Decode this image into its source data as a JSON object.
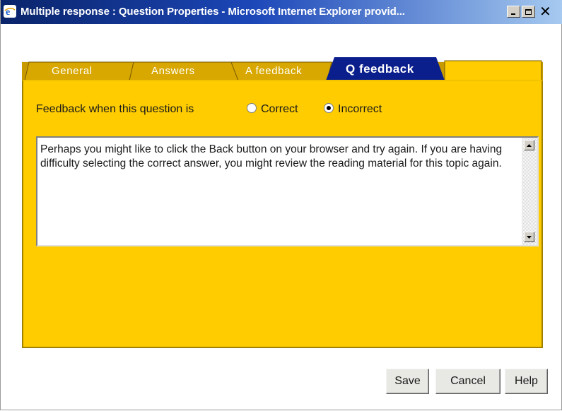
{
  "window": {
    "title": "Multiple response : Question Properties - Microsoft Internet Explorer provid..."
  },
  "tabs": [
    {
      "label": "General",
      "active": false
    },
    {
      "label": "Answers",
      "active": false
    },
    {
      "label": "A feedback",
      "active": false
    },
    {
      "label": "Q feedback",
      "active": true
    }
  ],
  "feedback": {
    "prompt": "Feedback when this question is",
    "options": [
      {
        "label": "Correct",
        "selected": false
      },
      {
        "label": "Incorrect",
        "selected": true
      }
    ],
    "text": "Perhaps you might like to click the Back button on your browser and try again. If you are having difficulty selecting the correct answer, you might review the reading material for this topic again."
  },
  "buttons": {
    "save": "Save",
    "cancel": "Cancel",
    "help": "Help"
  },
  "colors": {
    "panel": "#ffcc00",
    "active_tab": "#0a1f8c",
    "inactive_tab": "#d4a800",
    "titlebar_start": "#0a246a",
    "titlebar_end": "#a6caf0"
  },
  "icons": {
    "title": "ie-icon",
    "minimize": "minimize-icon",
    "maximize": "maximize-icon",
    "close": "close-icon",
    "scroll_up": "scroll-up-arrow-icon",
    "scroll_down": "scroll-down-arrow-icon"
  }
}
